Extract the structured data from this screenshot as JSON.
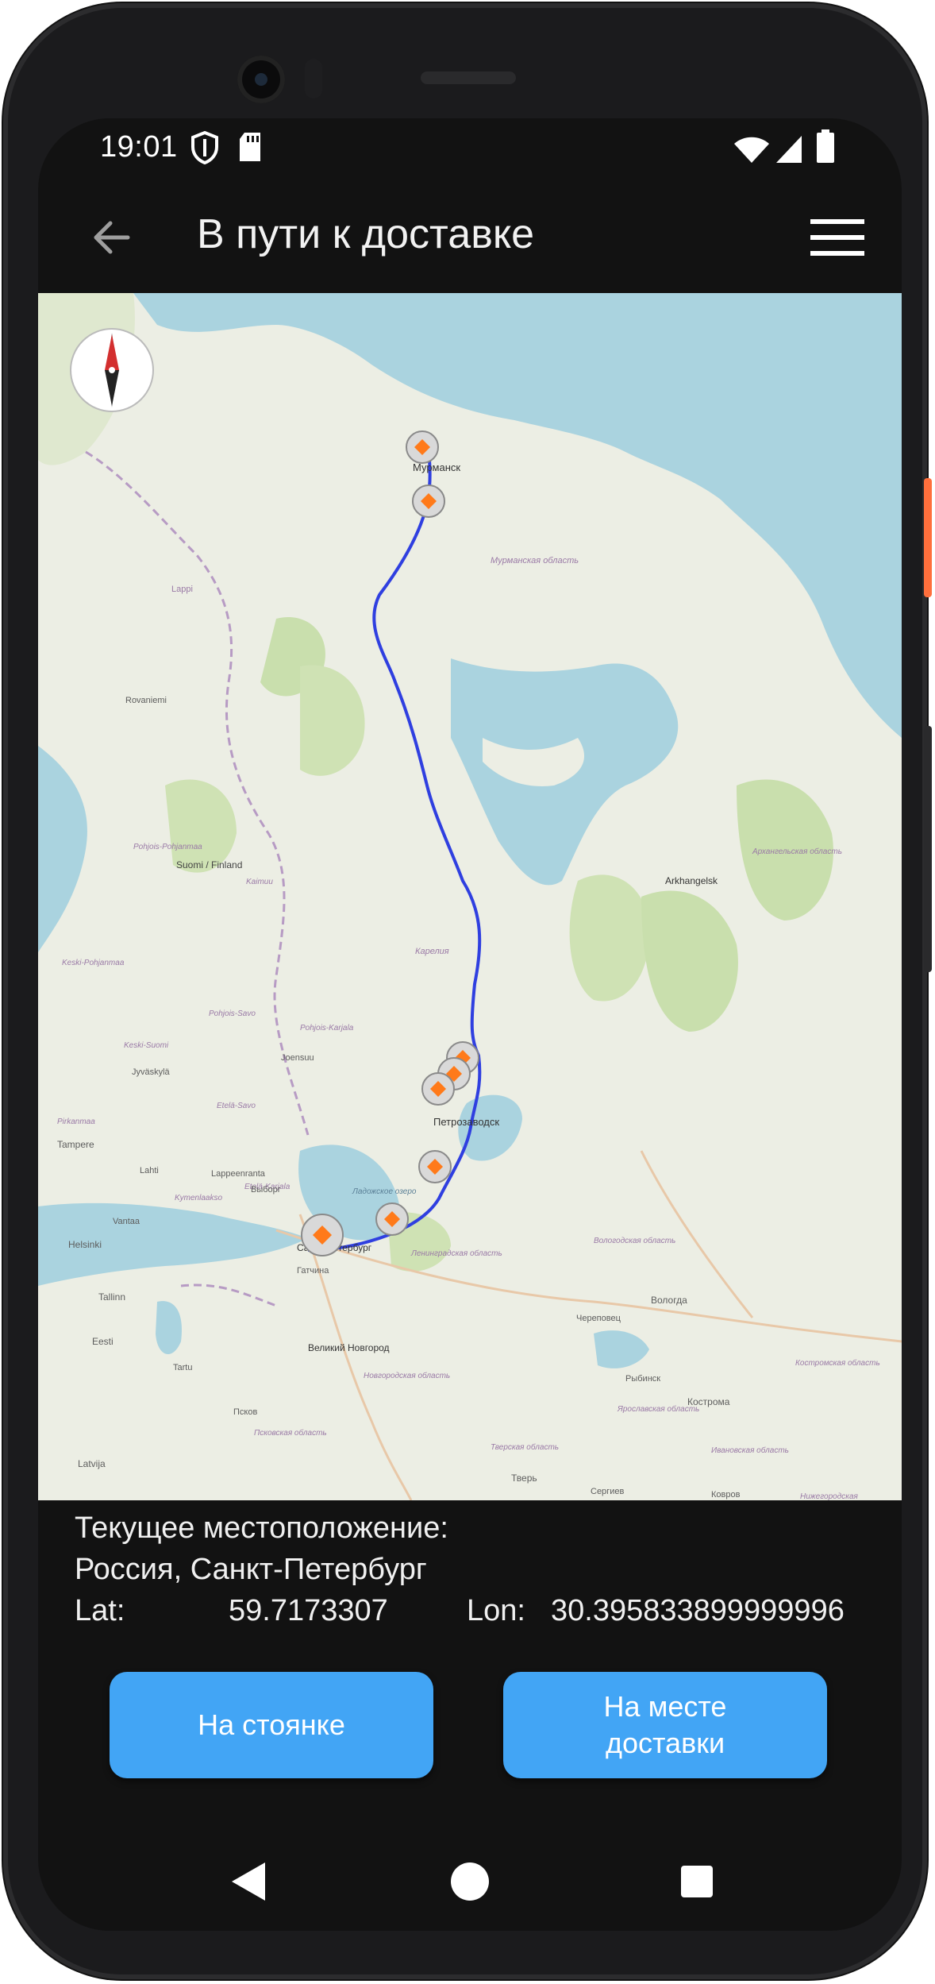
{
  "status_bar": {
    "time": "19:01",
    "left_icons": [
      "shield-icon",
      "sd-card-icon"
    ],
    "right_icons": [
      "wifi-icon",
      "cell-signal-icon",
      "battery-icon"
    ]
  },
  "app_bar": {
    "title": "В пути к доставке",
    "back_icon": "arrow-left-icon",
    "menu_icon": "hamburger-menu-icon"
  },
  "map": {
    "route_color": "#2f3fe0",
    "marker_color": "#ff7a1a",
    "labels": {
      "murmansk": "Мурманск",
      "murmansk_obl": "Мурманская область",
      "lappi": "Lappi",
      "rovaniemi": "Rovaniemi",
      "suomi": "Suomi / Finland",
      "pohjois": "Pohjois-Pohjanmaa",
      "kainuu": "Kaimuu",
      "kareliya": "Карелия",
      "arkhangelsk": "Arkhangelsk",
      "arkh_obl": "Архангельская область",
      "petrozavodsk": "Петрозаводск",
      "joensuu": "Joensuu",
      "pohjois_savo": "Pohjois-Savo",
      "pohjois_karjala": "Pohjois-Karjala",
      "etela_savo": "Etelä-Savo",
      "jyvaskyla": "Jyväskylä",
      "keski_suomi": "Keski-Suomi",
      "keski_pohjanmaa": "Keski-Pohjanmaa",
      "tampere": "Tampere",
      "pirkanmaa": "Pirkanmaa",
      "lappeenranta": "Lappeenranta",
      "etela_karjala": "Etelä-Karjala",
      "lahti": "Lahti",
      "kymenlaakso": "Kymenlaakso",
      "vyborg": "Выборг",
      "vantaa": "Vantaa",
      "helsinki": "Helsinki",
      "ladoga": "Ладожское озеро",
      "spb": "Санкт-Петербург",
      "gatchina": "Гатчина",
      "len_obl": "Ленинградская область",
      "vologda_obl": "Вологодская область",
      "vologda": "Вологда",
      "cherepovets": "Череповец",
      "tallinn": "Tallinn",
      "eesti": "Eesti",
      "tartu": "Tartu",
      "novgorod": "Великий Новгород",
      "novgorod_obl": "Новгородская область",
      "pskov": "Псков",
      "pskov_obl": "Псковская область",
      "latvija": "Latvija",
      "tver": "Тверь",
      "rybinsk": "Рыбинск",
      "yaroslavl_obl": "Ярославская область",
      "kostroma": "Кострома",
      "kostroma_obl": "Костромская область",
      "ivanovo_obl": "Ивановская область",
      "tver_obl": "Тверская область",
      "sergiev": "Сергиев",
      "kovrov": "Ковров",
      "nizhegorod": "Нижегородская"
    }
  },
  "info": {
    "current_location_label": "Текущее местоположение:",
    "address": "Россия, Санкт-Петербург",
    "lat_label": "Lat:",
    "lat_value": "59.7173307",
    "lon_label": "Lon:",
    "lon_value": "30.395833899999996"
  },
  "buttons": {
    "parking": "На стоянке",
    "arrived": "На месте доставки",
    "accent": "#42a5f5"
  },
  "nav_bar": {
    "back_icon": "triangle-back-icon",
    "home_icon": "circle-home-icon",
    "recents_icon": "square-recents-icon"
  }
}
